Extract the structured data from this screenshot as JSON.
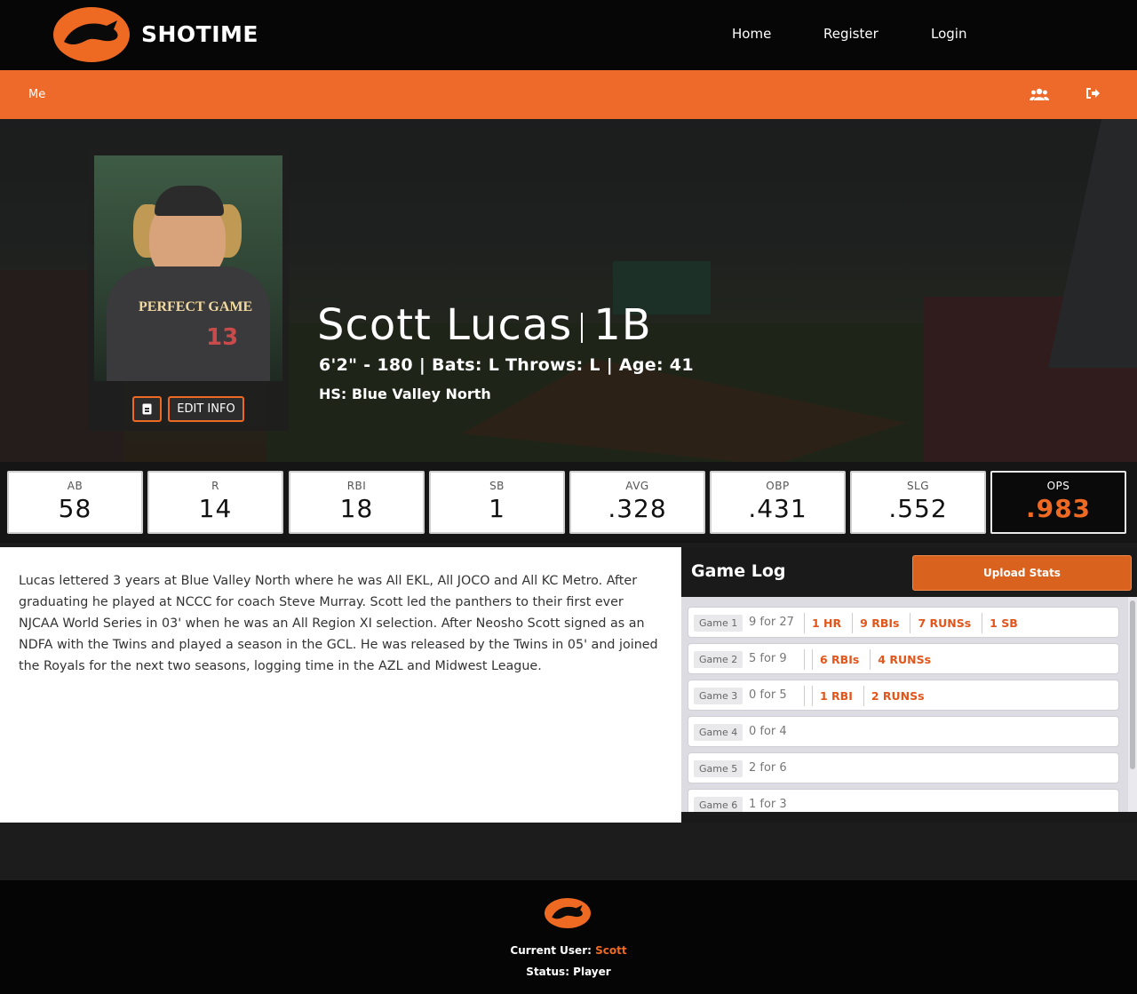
{
  "header": {
    "brand": "SHOTIME",
    "nav": [
      "Home",
      "Register",
      "Login"
    ]
  },
  "subbar": {
    "me_label": "Me"
  },
  "player": {
    "name": "Scott Lucas",
    "position": "1B",
    "details": "6'2\" - 180 | Bats: L Throws: L | Age: 41",
    "high_school": "HS: Blue Valley North",
    "jersey_text": "PERFECT GAME",
    "jersey_number": "13",
    "edit_label": "EDIT INFO"
  },
  "stats": [
    {
      "label": "AB",
      "value": "58"
    },
    {
      "label": "R",
      "value": "14"
    },
    {
      "label": "RBI",
      "value": "18"
    },
    {
      "label": "SB",
      "value": "1"
    },
    {
      "label": "AVG",
      "value": ".328"
    },
    {
      "label": "OBP",
      "value": ".431"
    },
    {
      "label": "SLG",
      "value": ".552"
    },
    {
      "label": "OPS",
      "value": ".983"
    }
  ],
  "bio": "Lucas lettered 3 years at Blue Valley North where he was All EKL, All JOCO and All KC Metro. After graduating he played at NCCC for coach Steve Murray. Scott led the panthers to their first ever NJCAA World Series in 03' when he was an All Region XI selection. After Neosho Scott signed as an NDFA with the Twins and played a season in the GCL. He was released by the Twins in 05' and joined the Royals for the next two seasons, logging time in the AZL and Midwest League.",
  "game_log": {
    "title": "Game Log",
    "upload_label": "Upload Stats",
    "games": [
      {
        "game": "Game 1",
        "record": "9 for 27",
        "stats": [
          "1 HR",
          "9 RBIs",
          "7 RUNSs",
          "1 SB"
        ]
      },
      {
        "game": "Game 2",
        "record": "5 for 9",
        "stats": [
          "",
          "6 RBIs",
          "4 RUNSs"
        ]
      },
      {
        "game": "Game 3",
        "record": "0 for 5",
        "stats": [
          "",
          "1 RBI",
          "2 RUNSs"
        ]
      },
      {
        "game": "Game 4",
        "record": "0 for 4",
        "stats": []
      },
      {
        "game": "Game 5",
        "record": "2 for 6",
        "stats": []
      },
      {
        "game": "Game 6",
        "record": "1 for 3",
        "stats": []
      }
    ]
  },
  "footer": {
    "current_user_label": "Current User:",
    "current_user": "Scott",
    "status": "Status: Player"
  },
  "colors": {
    "accent": "#ee6a22",
    "dark": "#060606"
  }
}
